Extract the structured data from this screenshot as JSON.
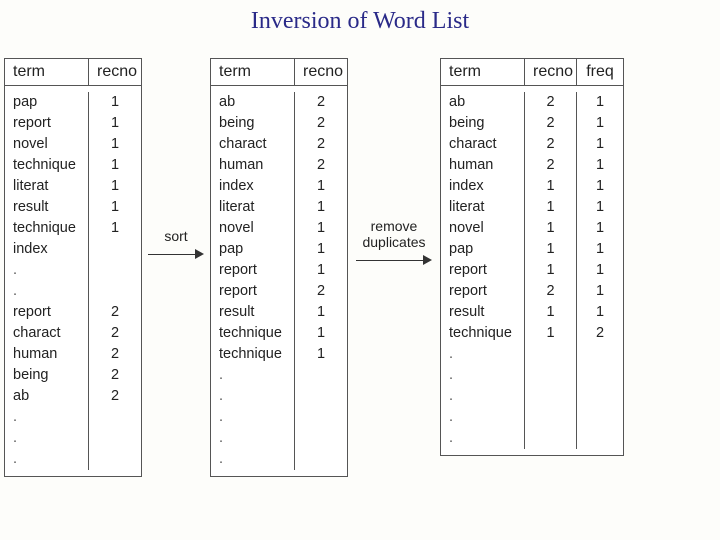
{
  "title": "Inversion of Word List",
  "arrows": {
    "sort": "sort",
    "dedup_line1": "remove",
    "dedup_line2": "duplicates"
  },
  "headers": {
    "term": "term",
    "recno": "recno",
    "freq": "freq"
  },
  "table1": {
    "rows": [
      {
        "term": "pap",
        "recno": "1"
      },
      {
        "term": "report",
        "recno": "1"
      },
      {
        "term": "novel",
        "recno": "1"
      },
      {
        "term": "technique",
        "recno": "1"
      },
      {
        "term": "literat",
        "recno": "1"
      },
      {
        "term": "result",
        "recno": "1"
      },
      {
        "term": "technique",
        "recno": "1"
      },
      {
        "term": "index",
        "recno": ""
      },
      {
        "term": ".",
        "recno": ""
      },
      {
        "term": ".",
        "recno": ""
      },
      {
        "term": "report",
        "recno": "2"
      },
      {
        "term": "charact",
        "recno": "2"
      },
      {
        "term": "human",
        "recno": "2"
      },
      {
        "term": "being",
        "recno": "2"
      },
      {
        "term": "ab",
        "recno": "2"
      },
      {
        "term": "",
        "recno": ""
      },
      {
        "term": ".",
        "recno": ""
      },
      {
        "term": ".",
        "recno": ""
      },
      {
        "term": ".",
        "recno": ""
      }
    ]
  },
  "table2": {
    "rows": [
      {
        "term": "ab",
        "recno": "2"
      },
      {
        "term": "being",
        "recno": "2"
      },
      {
        "term": "charact",
        "recno": "2"
      },
      {
        "term": "human",
        "recno": "2"
      },
      {
        "term": "index",
        "recno": "1"
      },
      {
        "term": "literat",
        "recno": "1"
      },
      {
        "term": "novel",
        "recno": "1"
      },
      {
        "term": "pap",
        "recno": "1"
      },
      {
        "term": "report",
        "recno": "1"
      },
      {
        "term": "report",
        "recno": "2"
      },
      {
        "term": "result",
        "recno": "1"
      },
      {
        "term": "technique",
        "recno": "1"
      },
      {
        "term": "technique",
        "recno": "1"
      },
      {
        "term": ".",
        "recno": ""
      },
      {
        "term": ".",
        "recno": ""
      },
      {
        "term": ".",
        "recno": ""
      },
      {
        "term": ".",
        "recno": ""
      },
      {
        "term": ".",
        "recno": ""
      }
    ]
  },
  "table3": {
    "rows": [
      {
        "term": "ab",
        "recno": "2",
        "freq": "1"
      },
      {
        "term": "being",
        "recno": "2",
        "freq": "1"
      },
      {
        "term": "charact",
        "recno": "2",
        "freq": "1"
      },
      {
        "term": "human",
        "recno": "2",
        "freq": "1"
      },
      {
        "term": "index",
        "recno": "1",
        "freq": "1"
      },
      {
        "term": "literat",
        "recno": "1",
        "freq": "1"
      },
      {
        "term": "novel",
        "recno": "1",
        "freq": "1"
      },
      {
        "term": "pap",
        "recno": "1",
        "freq": "1"
      },
      {
        "term": "report",
        "recno": "1",
        "freq": "1"
      },
      {
        "term": "report",
        "recno": "2",
        "freq": "1"
      },
      {
        "term": "result",
        "recno": "1",
        "freq": "1"
      },
      {
        "term": "technique",
        "recno": "1",
        "freq": "2"
      },
      {
        "term": "",
        "recno": "",
        "freq": ""
      },
      {
        "term": ".",
        "recno": "",
        "freq": ""
      },
      {
        "term": ".",
        "recno": "",
        "freq": ""
      },
      {
        "term": ".",
        "recno": "",
        "freq": ""
      },
      {
        "term": ".",
        "recno": "",
        "freq": ""
      },
      {
        "term": ".",
        "recno": "",
        "freq": ""
      }
    ]
  }
}
